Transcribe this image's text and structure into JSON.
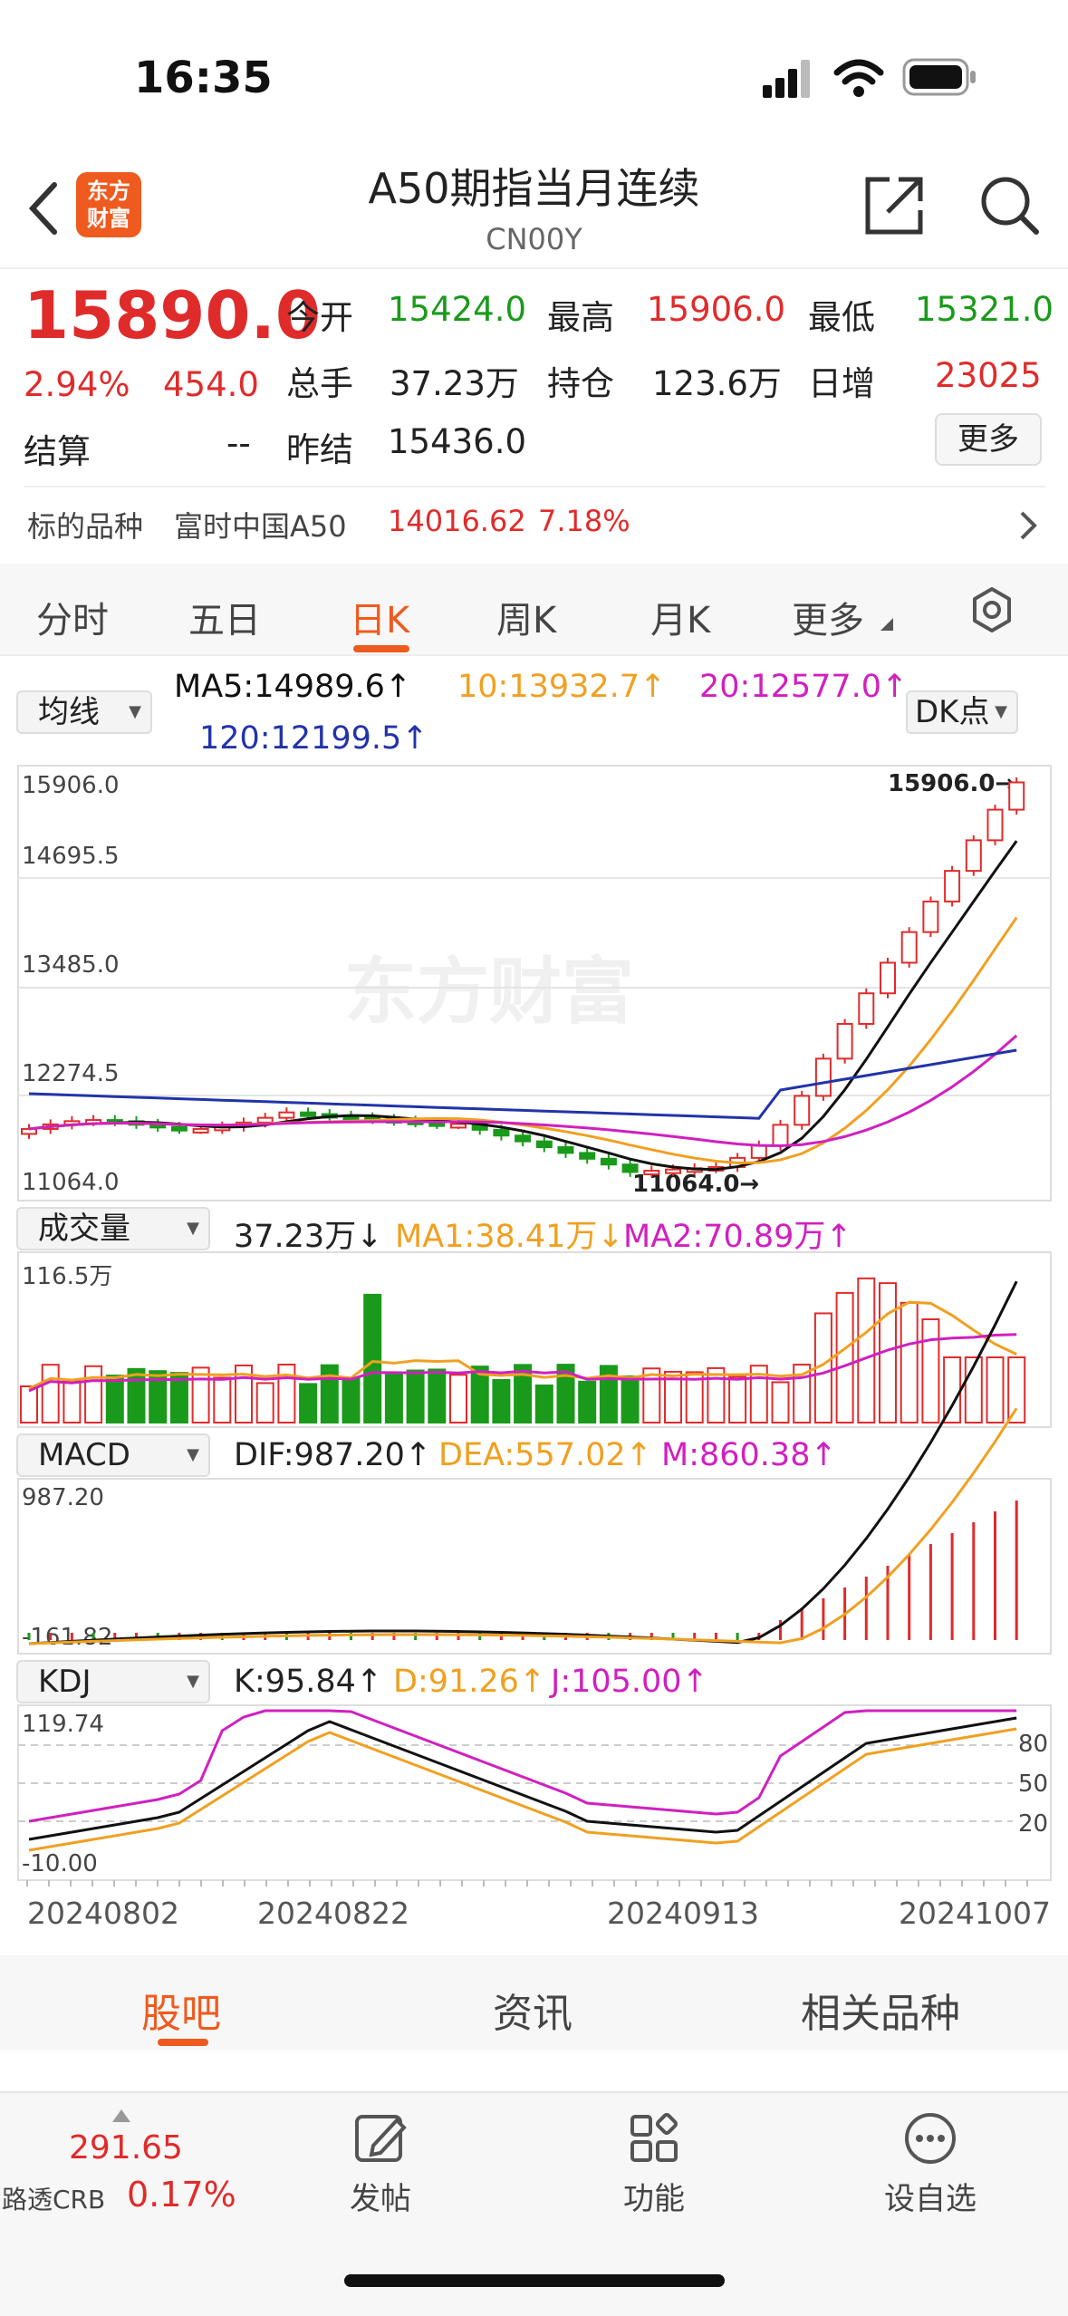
{
  "status_bar": {
    "time": "16:35"
  },
  "header": {
    "back_icon": "chevron-left-icon",
    "logo_text_line1": "东方",
    "logo_text_line2": "财富",
    "title": "A50期指当月连续",
    "code": "CN00Y",
    "share_icon": "share-icon",
    "search_icon": "search-icon"
  },
  "quote": {
    "price": "15890.0",
    "change_pct": "2.94%",
    "change": "454.0",
    "open_label": "今开",
    "open": "15424.0",
    "high_label": "最高",
    "high": "15906.0",
    "low_label": "最低",
    "low": "15321.0",
    "volume_label": "总手",
    "volume": "37.23万",
    "position_label": "持仓",
    "position": "123.6万",
    "daily_inc_label": "日增",
    "daily_inc": "23025",
    "settle_label": "结算",
    "settle": "--",
    "prev_settle_label": "昨结",
    "prev_settle": "15436.0",
    "more_button": "更多"
  },
  "underlying": {
    "label": "标的品种",
    "name": "富时中国A50",
    "price": "14016.62",
    "change_pct": "7.18%"
  },
  "tabs": [
    "分时",
    "五日",
    "日K",
    "周K",
    "月K",
    "更多"
  ],
  "active_tab": "日K",
  "kline": {
    "ma_selector": "均线",
    "ma5": "MA5:14989.6↑",
    "ma10": "10:13932.7↑",
    "ma20": "20:12577.0↑",
    "ma120": "120:12199.5↑",
    "dk_button": "DK点",
    "y_labels": [
      "15906.0",
      "14695.5",
      "13485.0",
      "12274.5",
      "11064.0"
    ],
    "max_label": "15906.0→",
    "min_label": "11064.0→",
    "watermark": "东方财富"
  },
  "volume": {
    "selector": "成交量",
    "value": "37.23万↓",
    "ma1": "MA1:38.41万↓",
    "ma2": "MA2:70.89万↑",
    "y_label": "116.5万"
  },
  "macd": {
    "selector": "MACD",
    "dif": "DIF:987.20↑",
    "dea": "DEA:557.02↑",
    "m": "M:860.38↑",
    "y_top": "987.20",
    "y_bottom": "-161.82"
  },
  "kdj": {
    "selector": "KDJ",
    "k": "K:95.84↑",
    "d": "D:91.26↑",
    "j": "J:105.00↑",
    "y_top": "119.74",
    "y_bottom": "-10.00",
    "levels": [
      "80",
      "50",
      "20"
    ]
  },
  "dates": [
    "20240802",
    "20240822",
    "20240913",
    "20241007"
  ],
  "bottom_tabs": [
    "股吧",
    "资讯",
    "相关品种"
  ],
  "active_bottom_tab": "股吧",
  "tab_bar": {
    "crb_value": "291.65",
    "crb_label": "路透CRB",
    "crb_change": "0.17%",
    "post": "发帖",
    "function": "功能",
    "add_watch": "设自选"
  },
  "colors": {
    "up": "#e02b2b",
    "down": "#1a9a1a",
    "accent": "#ef5a1e",
    "ma5": "#111111",
    "ma10": "#f0a020",
    "ma20": "#d020c0",
    "ma120": "#2233aa"
  }
}
